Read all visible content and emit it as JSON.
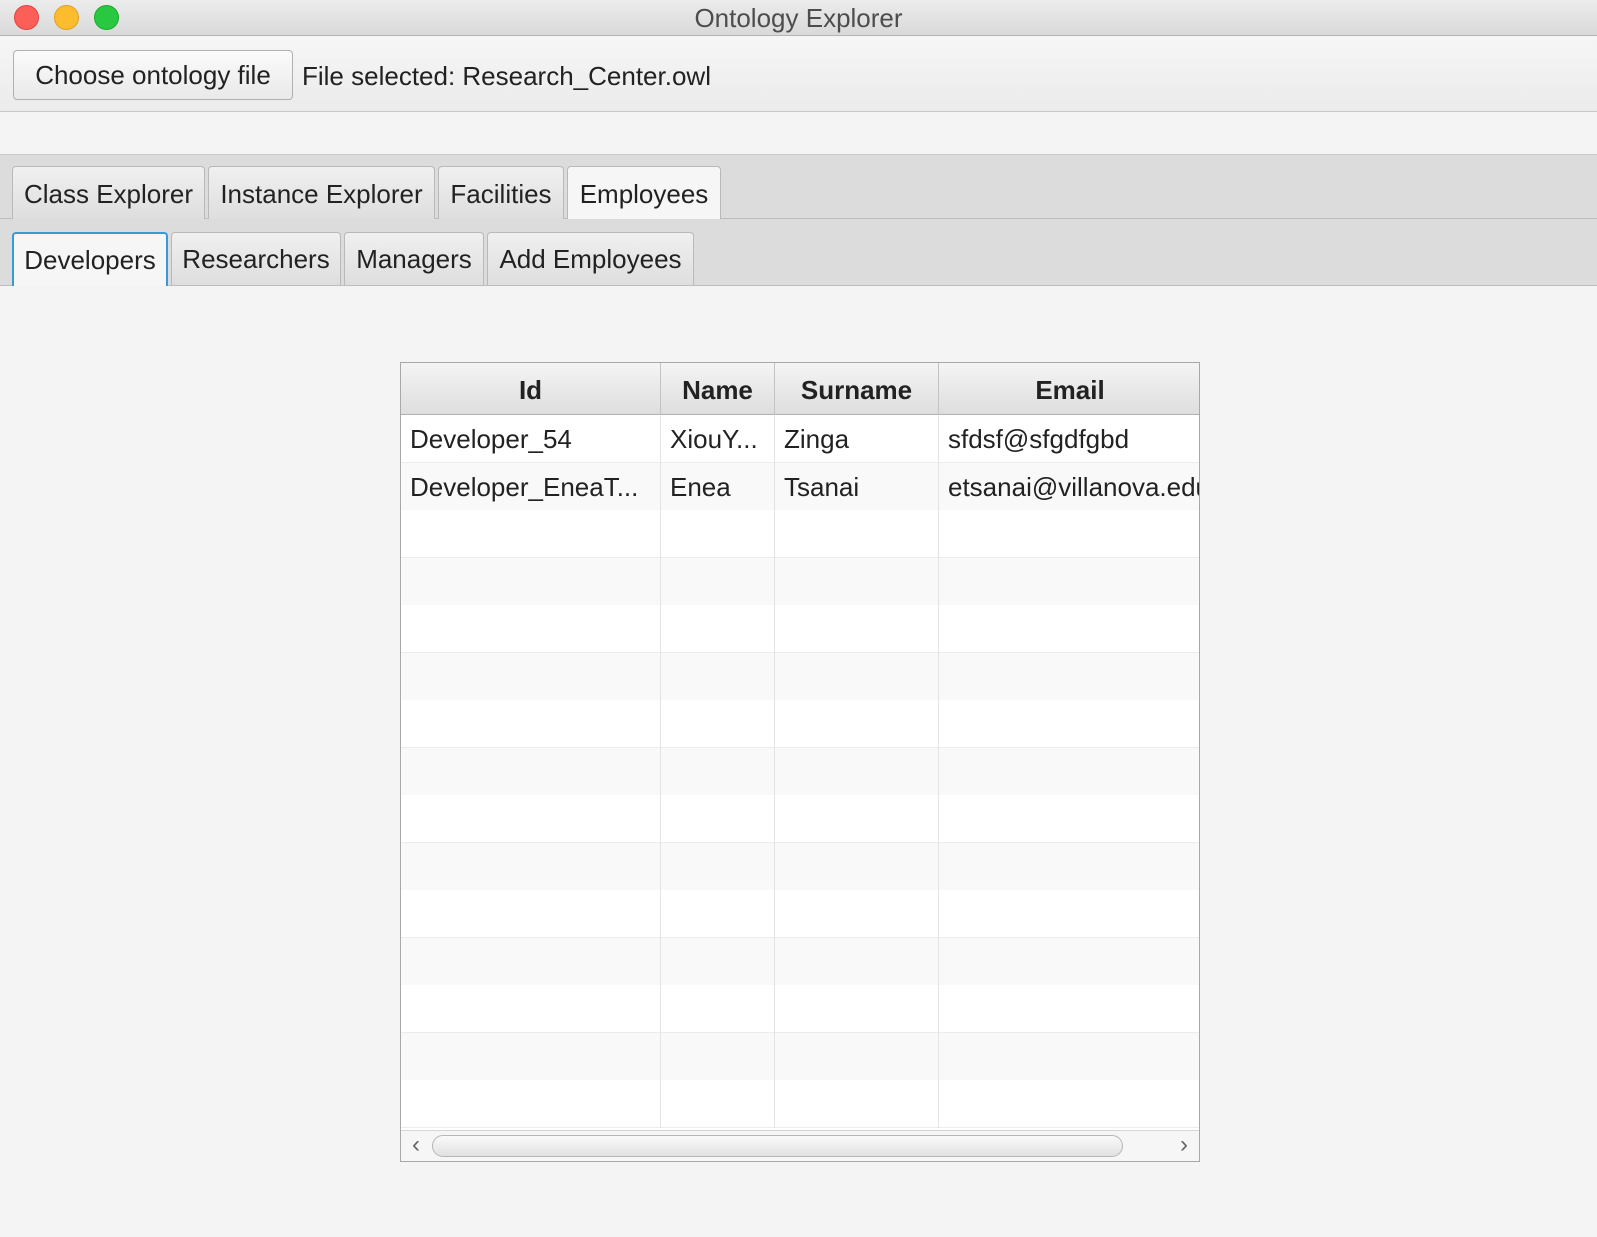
{
  "window": {
    "title": "Ontology Explorer"
  },
  "toolbar": {
    "choose_label": "Choose ontology file",
    "file_selected": "File selected: Research_Center.owl"
  },
  "main_tabs": [
    {
      "label": "Class Explorer"
    },
    {
      "label": "Instance Explorer"
    },
    {
      "label": "Facilities"
    },
    {
      "label": "Employees",
      "selected": true
    }
  ],
  "employee_tabs": [
    {
      "label": "Developers",
      "selected": true
    },
    {
      "label": "Researchers"
    },
    {
      "label": "Managers"
    },
    {
      "label": "Add Employees"
    }
  ],
  "table": {
    "columns": [
      "Id",
      "Name",
      "Surname",
      "Email"
    ],
    "rows": [
      [
        "Developer_54",
        "XiouY...",
        "Zinga",
        "sfdsf@sfgdfgbd"
      ],
      [
        "Developer_EneaT...",
        "Enea",
        "Tsanai",
        "etsanai@villanova.edu"
      ],
      [
        "",
        "",
        "",
        ""
      ],
      [
        "",
        "",
        "",
        ""
      ],
      [
        "",
        "",
        "",
        ""
      ],
      [
        "",
        "",
        "",
        ""
      ],
      [
        "",
        "",
        "",
        ""
      ],
      [
        "",
        "",
        "",
        ""
      ],
      [
        "",
        "",
        "",
        ""
      ],
      [
        "",
        "",
        "",
        ""
      ],
      [
        "",
        "",
        "",
        ""
      ],
      [
        "",
        "",
        "",
        ""
      ],
      [
        "",
        "",
        "",
        ""
      ],
      [
        "",
        "",
        "",
        ""
      ],
      [
        "",
        "",
        "",
        ""
      ]
    ]
  },
  "scrollbar": {
    "left_arrow": "‹",
    "right_arrow": "›"
  },
  "colors": {
    "selected_tab_border": "#3a9ad9",
    "close": "#fc5f57",
    "minimize": "#fdbc2e",
    "maximize": "#28c840"
  }
}
